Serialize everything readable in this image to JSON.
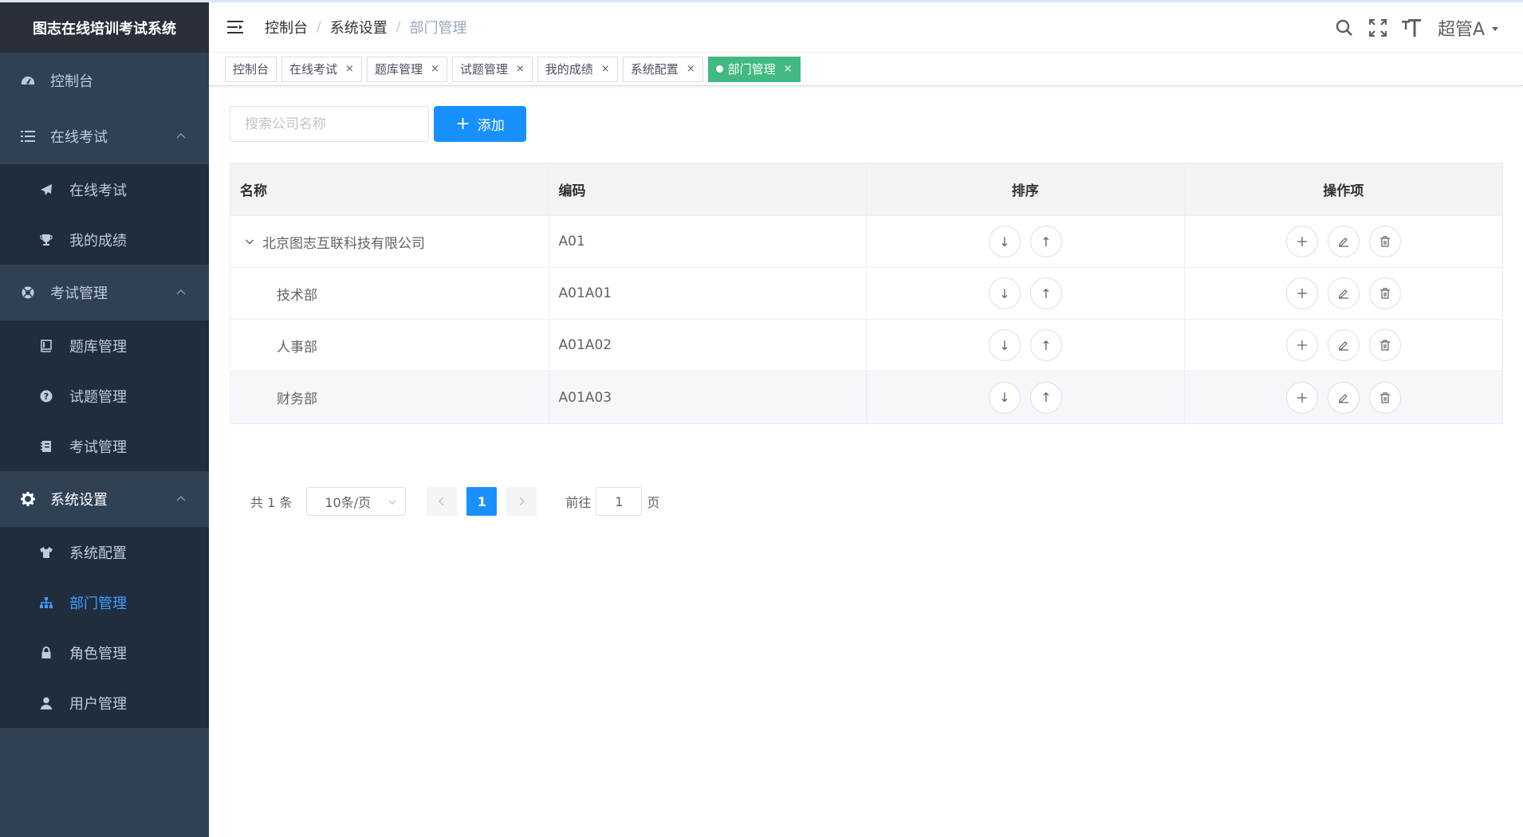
{
  "app_title": "图志在线培训考试系统",
  "sidebar": {
    "dashboard": "控制台",
    "groups": [
      {
        "label": "在线考试",
        "items": [
          "在线考试",
          "我的成绩"
        ]
      },
      {
        "label": "考试管理",
        "items": [
          "题库管理",
          "试题管理",
          "考试管理"
        ]
      },
      {
        "label": "系统设置",
        "items": [
          "系统配置",
          "部门管理",
          "角色管理",
          "用户管理"
        ]
      }
    ]
  },
  "header": {
    "breadcrumb": [
      "控制台",
      "系统设置",
      "部门管理"
    ],
    "separator": "/",
    "user": "超管A"
  },
  "tags": [
    {
      "label": "控制台"
    },
    {
      "label": "在线考试",
      "close": "×"
    },
    {
      "label": "题库管理",
      "close": "×"
    },
    {
      "label": "试题管理",
      "close": "×"
    },
    {
      "label": "我的成绩",
      "close": "×"
    },
    {
      "label": "系统配置",
      "close": "×"
    },
    {
      "label": "部门管理",
      "close": "×"
    }
  ],
  "toolbar": {
    "search_placeholder": "搜索公司名称",
    "add_label": "添加",
    "add_icon": "+"
  },
  "table": {
    "headers": [
      "名称",
      "编码",
      "排序",
      "操作项"
    ],
    "rows": [
      {
        "name": "北京图志互联科技有限公司",
        "code": "A01"
      },
      {
        "name": "技术部",
        "code": "A01A01"
      },
      {
        "name": "人事部",
        "code": "A01A02"
      },
      {
        "name": "财务部",
        "code": "A01A03"
      }
    ],
    "sort_icons": [
      "↓",
      "↑"
    ],
    "action_icons": [
      "plus-icon",
      "edit-icon",
      "delete-icon"
    ]
  },
  "pagination": {
    "total": "共 1 条",
    "page_size": "10条/页",
    "current": "1",
    "goto_prefix": "前往",
    "goto_value": "1",
    "goto_suffix": "页"
  },
  "colors": {
    "sidebar_bg": "#304156",
    "submenu_bg": "#1f2d3d",
    "primary": "#1890ff",
    "active_tag": "#42b983",
    "active_menu": "#409eff"
  }
}
